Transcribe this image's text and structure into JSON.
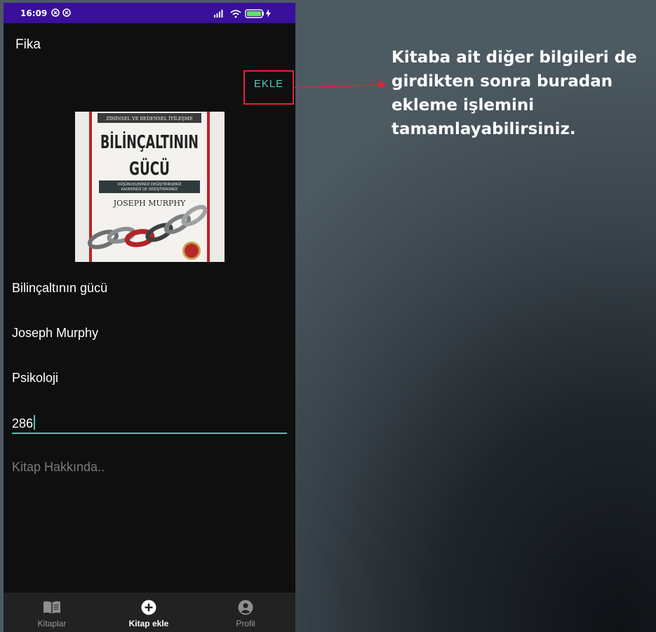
{
  "status_bar": {
    "time": "16:09",
    "battery": "90"
  },
  "app_bar": {
    "title": "Fika",
    "action_label": "EKLE"
  },
  "book_cover": {
    "subtitle_band": "ZİHİNSEL VE BEDENSEL İYİLEŞME",
    "title_line1": "BİLİNÇALTININ",
    "title_line2": "GÜCÜ",
    "tagline1": "DÜŞÜNCELERİNİZİ DEĞİŞTİRİRSENİZ",
    "tagline2": "KADERİNİZİ DE DEĞİŞTİRİRSİNİZ",
    "author": "JOSEPH MURPHY"
  },
  "form": {
    "title_value": "Bilinçaltının gücü",
    "author_value": "Joseph Murphy",
    "category_value": "Psikoloji",
    "pages_value": "286",
    "about_placeholder": "Kitap Hakkında.."
  },
  "bottom_nav": {
    "items": [
      {
        "label": "Kitaplar",
        "icon": "book-icon",
        "active": false
      },
      {
        "label": "Kitap ekle",
        "icon": "add-circle-icon",
        "active": true
      },
      {
        "label": "Profil",
        "icon": "account-circle-icon",
        "active": false
      }
    ]
  },
  "annotation": {
    "text": "Kitaba ait diğer bilgileri de girdikten sonra buradan ekleme işlemini tamamlayabilirsiniz.",
    "color": "#e2213c"
  },
  "colors": {
    "status_bar": "#3a0f9c",
    "accent": "#4ec3b2",
    "background": "#0f0f10",
    "nav_background": "#222222"
  }
}
